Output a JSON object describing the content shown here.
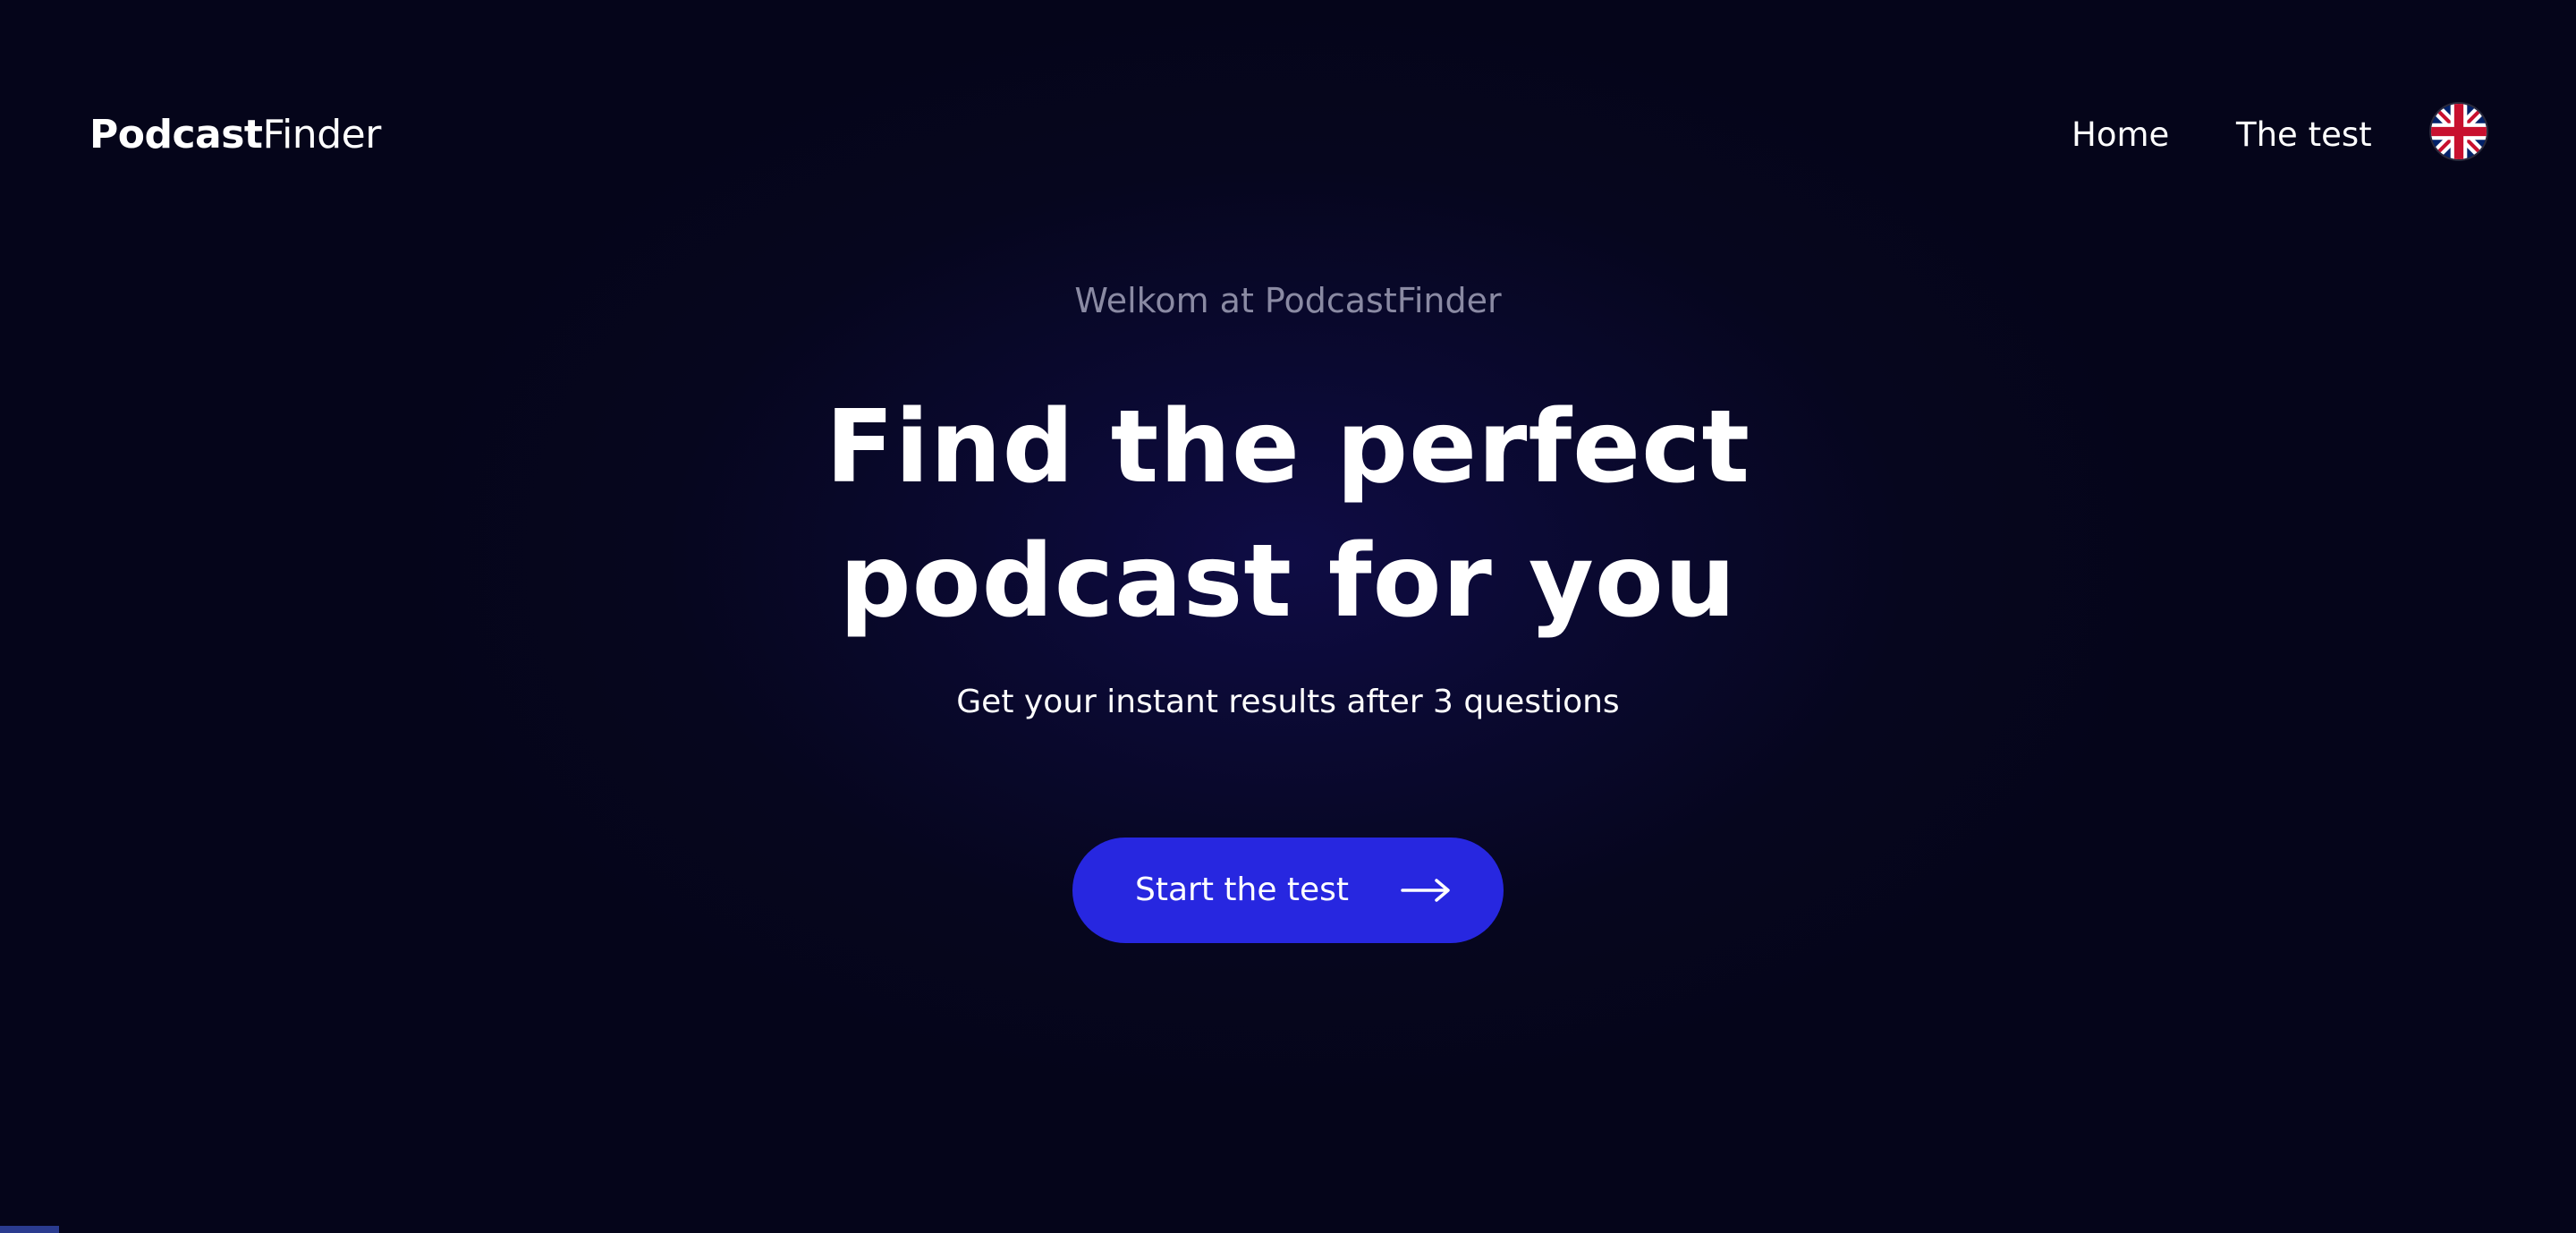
{
  "header": {
    "logo_bold": "Podcast",
    "logo_light": "Finder",
    "nav": {
      "home": "Home",
      "test": "The test"
    },
    "language_flag": "uk-flag-icon"
  },
  "hero": {
    "eyebrow": "Welkom at PodcastFinder",
    "headline_line1": "Find the perfect",
    "headline_line2": "podcast for you",
    "subtitle": "Get your instant results after 3 questions",
    "cta_label": "Start the test",
    "cta_icon": "arrow-right-icon"
  },
  "colors": {
    "background": "#05051a",
    "accent": "#2727e0",
    "muted_text": "#8a8aa3",
    "text": "#ffffff"
  }
}
